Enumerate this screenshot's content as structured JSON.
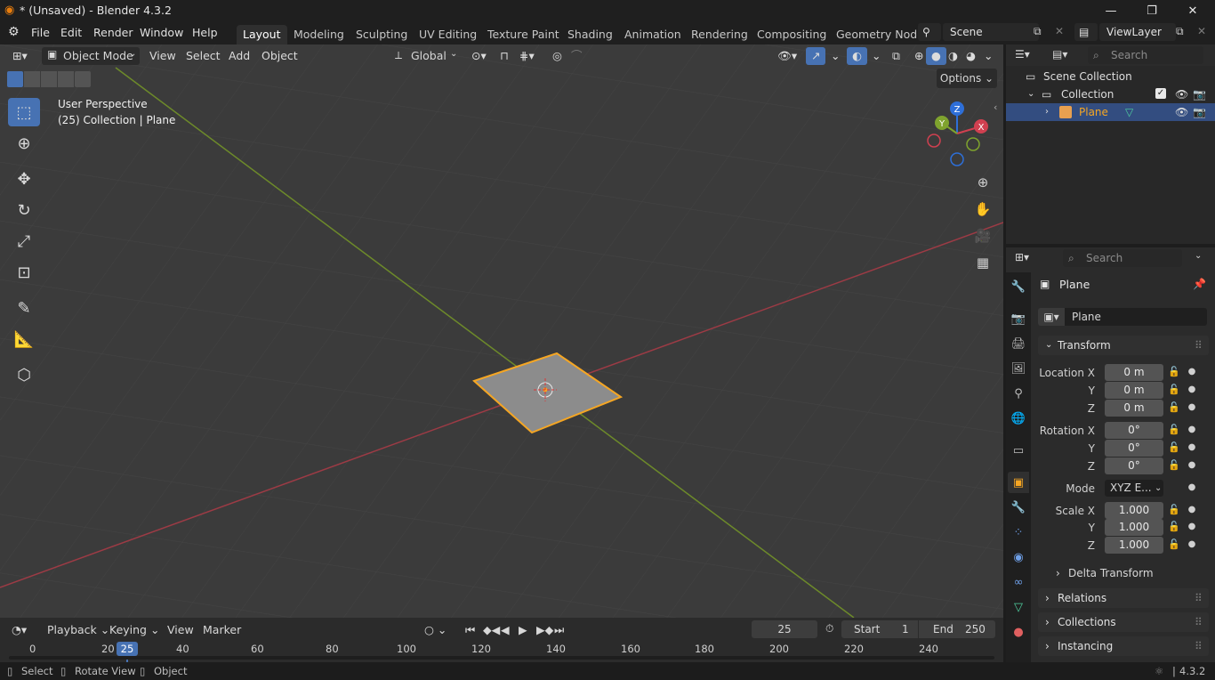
{
  "window": {
    "title": "* (Unsaved) - Blender 4.3.2",
    "minimize_icon": "minimize-icon",
    "maximize_icon": "maximize-icon",
    "close_icon": "close-icon"
  },
  "menu": {
    "items": [
      "File",
      "Edit",
      "Render",
      "Window",
      "Help"
    ]
  },
  "workspaces": {
    "tabs": [
      "Layout",
      "Modeling",
      "Sculpting",
      "UV Editing",
      "Texture Paint",
      "Shading",
      "Animation",
      "Rendering",
      "Compositing",
      "Geometry Node"
    ],
    "active": "Layout"
  },
  "scene": {
    "name": "Scene",
    "view_layer": "ViewLayer"
  },
  "viewport": {
    "mode": "Object Mode",
    "header_menus": [
      "View",
      "Select",
      "Add",
      "Object"
    ],
    "orientation": "Global",
    "options_label": "Options",
    "overlay_text_1": "User Perspective",
    "overlay_text_2": "(25) Collection | Plane",
    "gizmo_labels": {
      "x": "X",
      "y": "Y",
      "z": "Z"
    },
    "colors": {
      "x_axis": "#9c3b45",
      "y_axis": "#6d8a2a",
      "selection": "#f5a623",
      "active_tool": "#4772b3"
    }
  },
  "outliner": {
    "search_placeholder": "Search",
    "rows": [
      "Scene Collection",
      "Collection",
      "Plane"
    ]
  },
  "properties": {
    "search_placeholder": "Search",
    "object_name": "Plane",
    "object_name_field": "Plane",
    "transform_header": "Transform",
    "labels": {
      "location_x": "Location X",
      "y": "Y",
      "z": "Z",
      "rotation_x": "Rotation X",
      "mode": "Mode",
      "scale_x": "Scale X"
    },
    "location": [
      "0 m",
      "0 m",
      "0 m"
    ],
    "rotation": [
      "0°",
      "0°",
      "0°"
    ],
    "rotation_mode": "XYZ E...",
    "scale": [
      "1.000",
      "1.000",
      "1.000"
    ],
    "sub_panels": [
      "Delta Transform",
      "Relations",
      "Collections",
      "Instancing"
    ]
  },
  "timeline": {
    "menus": [
      "Playback",
      "Keying",
      "View",
      "Marker"
    ],
    "current_frame": "25",
    "start_label": "Start",
    "start": "1",
    "end_label": "End",
    "end": "250",
    "ticks": [
      "0",
      "20",
      "40",
      "60",
      "80",
      "100",
      "120",
      "140",
      "160",
      "180",
      "200",
      "220",
      "240"
    ],
    "playhead": "25"
  },
  "statusbar": {
    "items": [
      "Select",
      "Rotate View",
      "Object"
    ],
    "version": "4.3.2"
  }
}
